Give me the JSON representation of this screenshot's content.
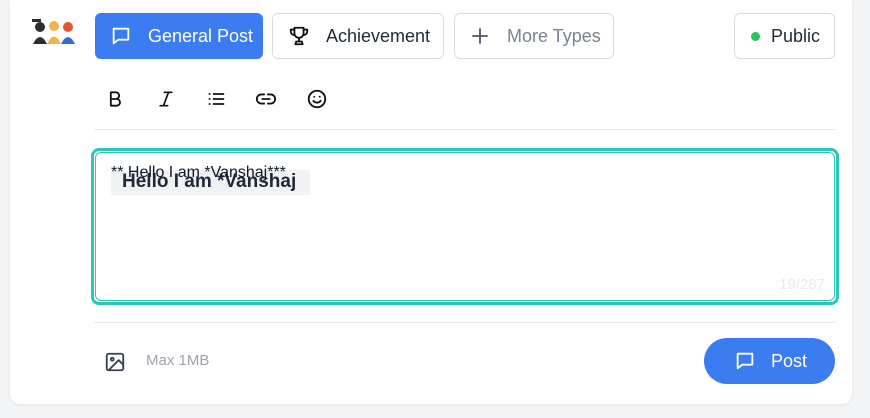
{
  "composer": {
    "types": {
      "general_label": "General Post",
      "achievement_label": "Achievement",
      "more_label": "More Types"
    },
    "visibility_label": "Public",
    "toolbar": {
      "icons": [
        "bold-icon",
        "italic-icon",
        "list-icon",
        "link-icon",
        "emoji-icon"
      ]
    },
    "editor": {
      "raw_text": "** Hello I am *Vanshaj***",
      "preview_text": "Hello I am *Vanshaj",
      "char_count": "19/287"
    },
    "footer": {
      "max_size_label": "Max 1MB",
      "post_label": "Post"
    },
    "colors": {
      "accent": "#3b7cf0",
      "editor_border": "#2ec4b6",
      "public_dot": "#22c55e"
    }
  }
}
